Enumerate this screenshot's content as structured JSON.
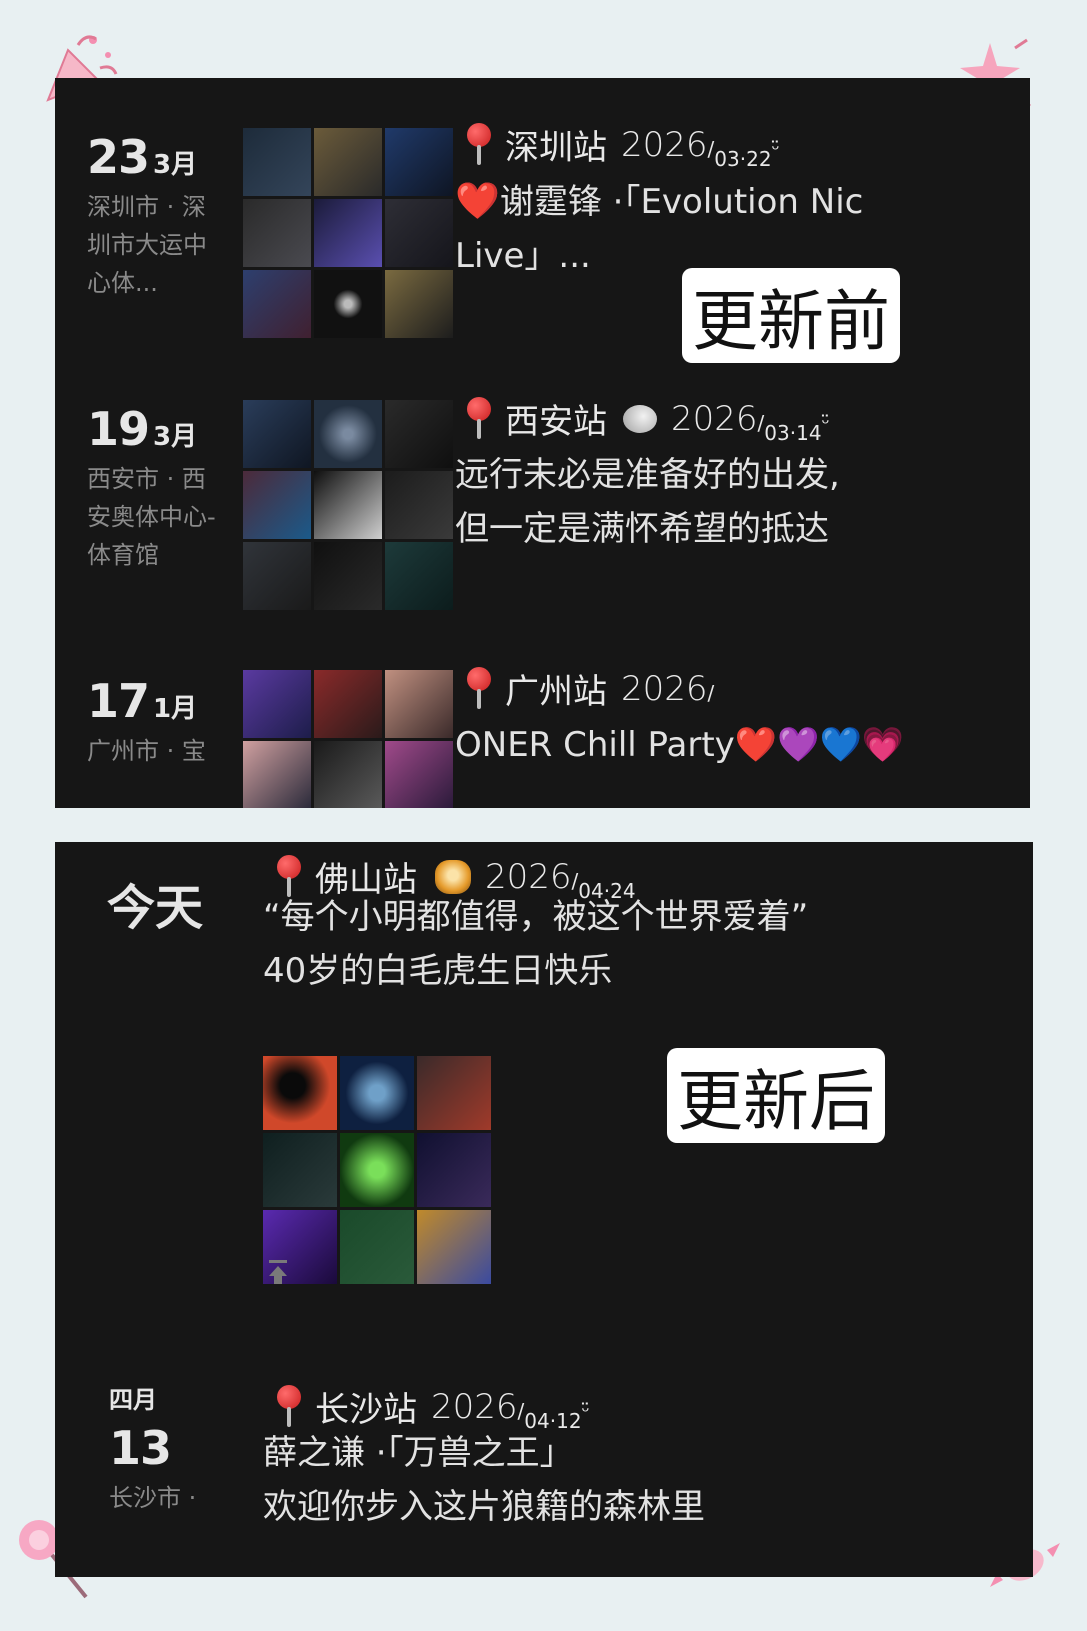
{
  "before": {
    "label": "更新前",
    "entries": [
      {
        "day": "23",
        "month": "3月",
        "location": "深圳市 · 深圳市大运中心体...",
        "place": "深圳站",
        "stamp_year": "2026",
        "stamp_date": "03·22",
        "stamp_suffix": "ᵕ̈",
        "text_line1": "谢霆锋 ·「Evolution Nic",
        "text_line2": "Live」...",
        "heart": "❤️"
      },
      {
        "day": "19",
        "month": "3月",
        "location": "西安市 · 西安奥体中心-体育馆",
        "place": "西安站",
        "stamp_year": "2026",
        "stamp_date": "03·14",
        "stamp_suffix": "ᵕ̈",
        "text_line1": "远行未必是准备好的出发,",
        "text_line2": "但一定是满怀希望的抵达"
      },
      {
        "day": "17",
        "month": "1月",
        "location": "广州市 · 宝",
        "place": "广州站",
        "stamp_year": "2026",
        "text_line1": "ONER Chill Party",
        "hearts": "❤️💜💙💗"
      }
    ]
  },
  "after": {
    "label": "更新后",
    "entries": [
      {
        "day_label": "今天",
        "place": "佛山站",
        "stamp_year": "2026",
        "stamp_date": "04·24",
        "text_line1": "“每个小明都值得，被这个世界爱着”",
        "text_line2": "40岁的白毛虎生日快乐"
      },
      {
        "month_label": "四月",
        "day": "13",
        "location": "长沙市 ·",
        "place": "长沙站",
        "stamp_year": "2026",
        "stamp_date": "04·12",
        "stamp_suffix": "ᵕ̈",
        "text_line1": "薛之谦 ·「万兽之王」",
        "text_line2": "欢迎你步入这片狼籍的森林里"
      }
    ]
  },
  "colors": {
    "page_bg": "#e8f0f2",
    "panel_bg": "#161616",
    "label_bg": "#ffffff",
    "accent_pink": "#f48fb1"
  },
  "icons": [
    "party-popper-icon",
    "sparkle-icon",
    "lollipop-icon",
    "candy-icon",
    "pin-icon",
    "scroll-top-icon",
    "chick-icon",
    "tiger-icon"
  ]
}
